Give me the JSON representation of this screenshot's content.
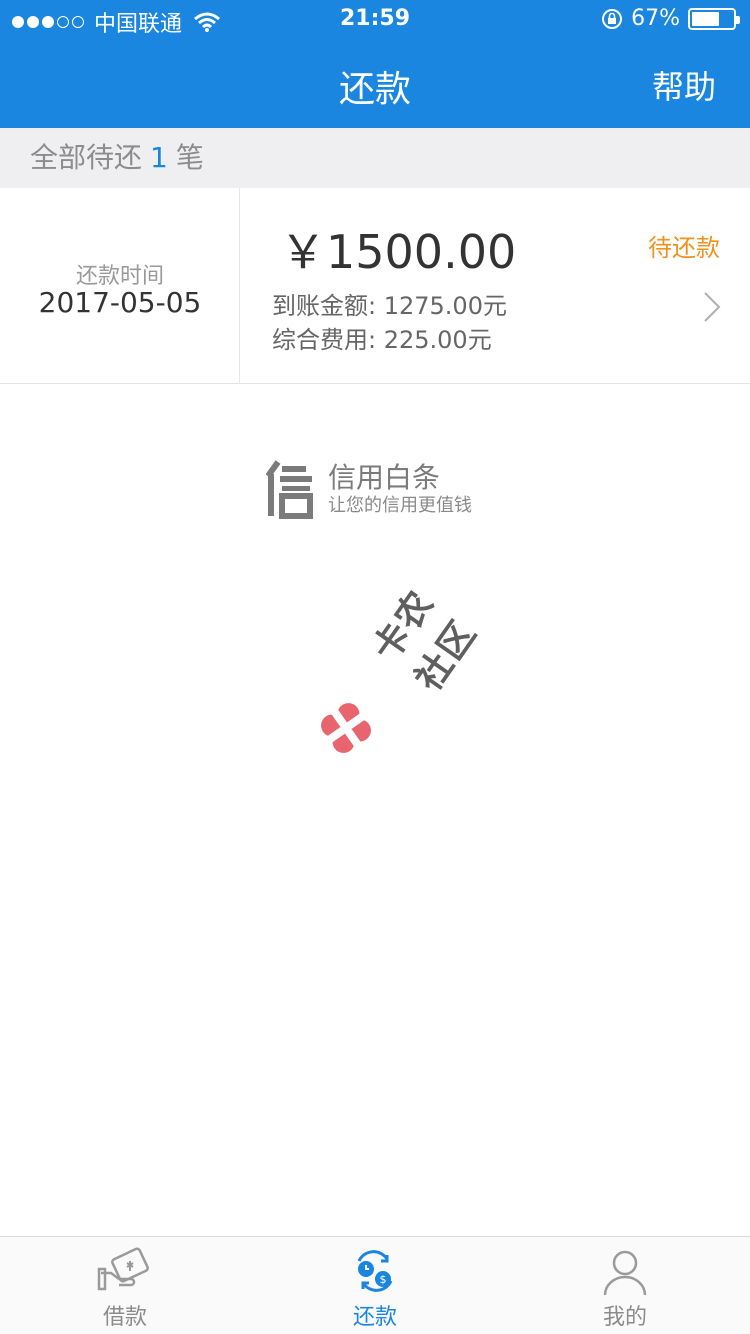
{
  "status_bar": {
    "carrier": "中国联通",
    "time": "21:59",
    "battery": "67%",
    "battery_level": 0.67,
    "signal_dots": 5,
    "signal_filled": 3
  },
  "nav": {
    "title": "还款",
    "help": "帮助"
  },
  "summary": {
    "prefix": "全部待还",
    "count": "1",
    "suffix": "笔"
  },
  "bill": {
    "date_label": "还款时间",
    "date": "2017-05-05",
    "amount": "￥1500.00",
    "received": "到账金额: 1275.00元",
    "fee": "综合费用: 225.00元",
    "status": "待还款"
  },
  "brand": {
    "name": "信用白条",
    "slogan": "让您的信用更值钱"
  },
  "watermark": {
    "text": "卡农社区"
  },
  "tabs": [
    {
      "label": "借款",
      "icon": "borrow-icon",
      "active": false
    },
    {
      "label": "还款",
      "icon": "repay-icon",
      "active": true
    },
    {
      "label": "我的",
      "icon": "profile-icon",
      "active": false
    }
  ],
  "colors": {
    "primary": "#1a86e0",
    "accent": "#f0921e",
    "summary_bg": "#efeff1"
  }
}
